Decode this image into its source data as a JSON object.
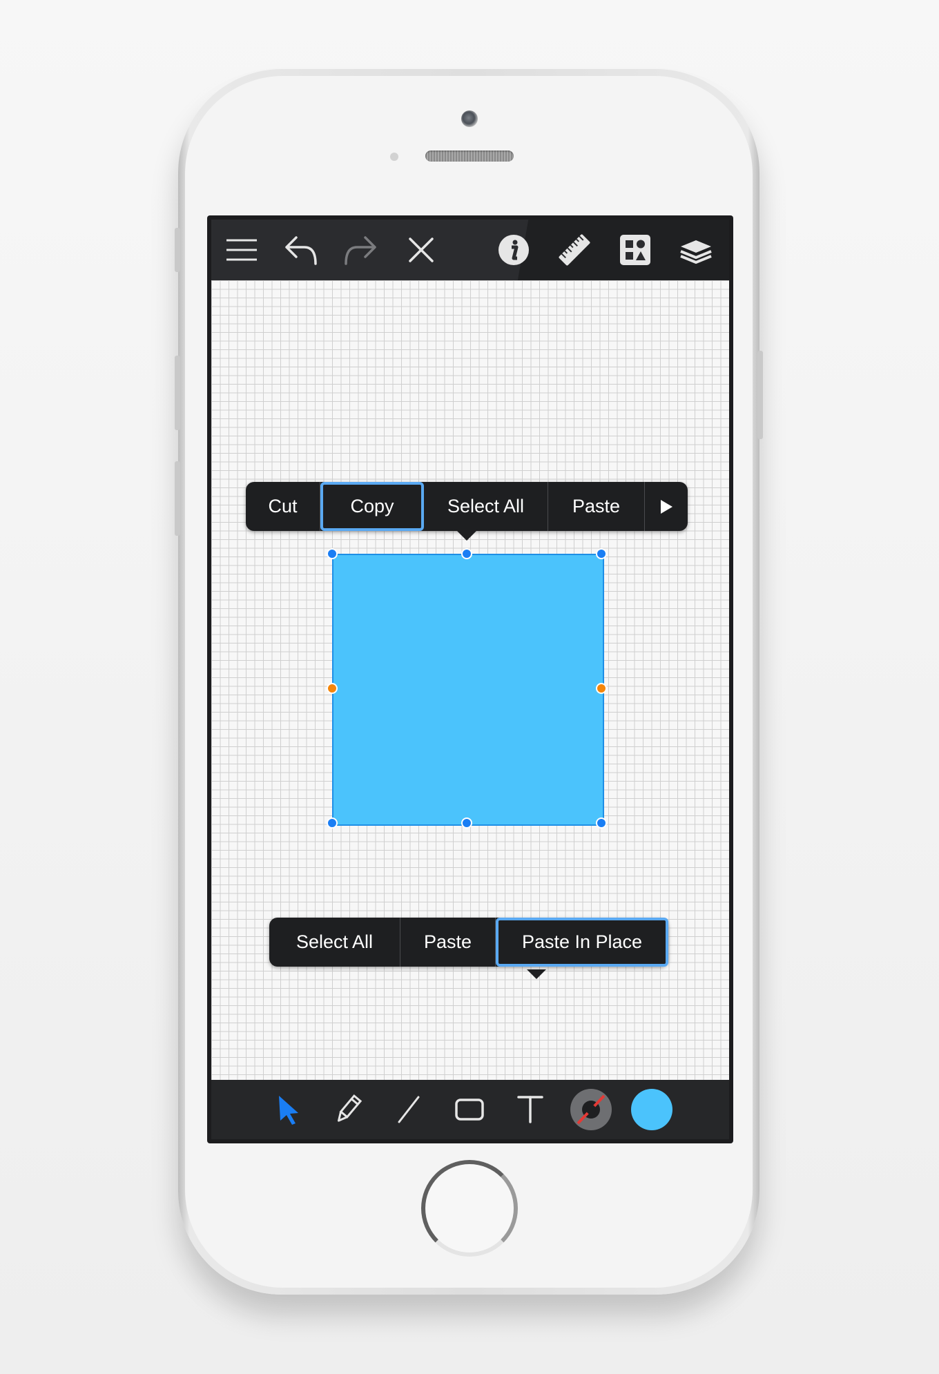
{
  "colors": {
    "accent": "#1a7ef4",
    "shape_fill": "#4bc3fc",
    "handle_side": "#f5860a",
    "selection_outline": "#5aa9f2",
    "toolbar": "#262729"
  },
  "top_toolbar": {
    "icons": [
      "menu-icon",
      "undo-icon",
      "redo-icon",
      "close-icon",
      "info-icon",
      "ruler-icon",
      "shapes-library-icon",
      "layers-icon"
    ]
  },
  "context_menu_top": {
    "items": [
      {
        "label": "Cut",
        "selected": false
      },
      {
        "label": "Copy",
        "selected": true
      },
      {
        "label": "Select All",
        "selected": false
      },
      {
        "label": "Paste",
        "selected": false
      }
    ],
    "more_icon": "play-arrow-icon"
  },
  "context_menu_bottom": {
    "items": [
      {
        "label": "Select All",
        "selected": false
      },
      {
        "label": "Paste",
        "selected": false
      },
      {
        "label": "Paste In Place",
        "selected": true
      }
    ]
  },
  "bottom_toolbar": {
    "tools": [
      "select-arrow-icon",
      "pencil-icon",
      "line-icon",
      "rectangle-icon",
      "text-icon",
      "stroke-color-icon",
      "fill-color-icon"
    ],
    "active_tool": "select-arrow-icon"
  }
}
